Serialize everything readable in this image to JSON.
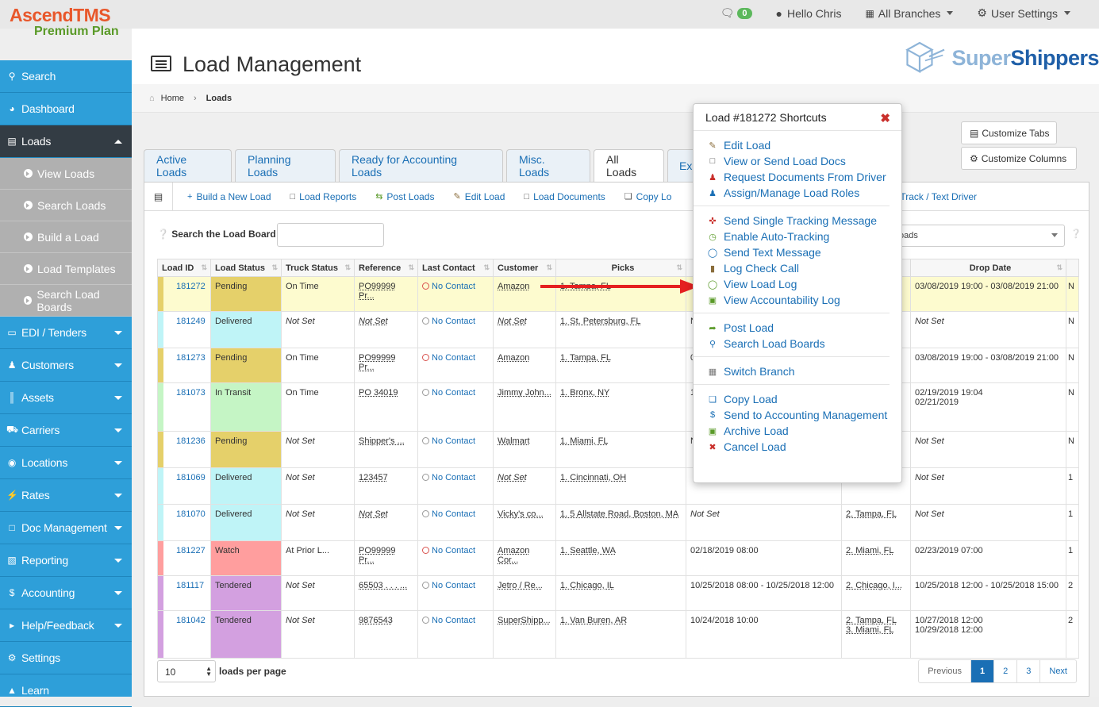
{
  "brand": {
    "name_a": "Ascend",
    "name_b": "TMS",
    "plan": "Premium Plan",
    "company_a": "Super",
    "company_b": "Shippers"
  },
  "top": {
    "messages_count": "0",
    "greeting": "Hello Chris",
    "branches": "All Branches",
    "settings": "User Settings"
  },
  "sidebar": {
    "items": [
      {
        "label": "Search",
        "icon": "search-icon"
      },
      {
        "label": "Dashboard",
        "icon": "dashboard-icon"
      },
      {
        "label": "Loads",
        "icon": "list-icon",
        "active": true
      },
      {
        "label": "EDI / Tenders",
        "icon": "inbox-icon"
      },
      {
        "label": "Customers",
        "icon": "users-icon"
      },
      {
        "label": "Assets",
        "icon": "barcode-icon"
      },
      {
        "label": "Carriers",
        "icon": "truck-icon"
      },
      {
        "label": "Locations",
        "icon": "map-marker-icon"
      },
      {
        "label": "Rates",
        "icon": "bolt-icon"
      },
      {
        "label": "Doc Management",
        "icon": "file-icon"
      },
      {
        "label": "Reporting",
        "icon": "report-icon"
      },
      {
        "label": "Accounting",
        "icon": "dollar-icon"
      },
      {
        "label": "Help/Feedback",
        "icon": "bullhorn-icon"
      },
      {
        "label": "Settings",
        "icon": "cogs-icon"
      },
      {
        "label": "Learn",
        "icon": "graduation-cap-icon"
      }
    ],
    "loads_sub": [
      "View Loads",
      "Search Loads",
      "Build a Load",
      "Load Templates",
      "Search Load Boards"
    ]
  },
  "page": {
    "title": "Load Management",
    "crumb_home": "Home",
    "crumb_current": "Loads"
  },
  "buttons": {
    "customize_tabs": "Customize Tabs",
    "customize_columns": "Customize Columns"
  },
  "tabs": [
    "Active Loads",
    "Planning Loads",
    "Ready for Accounting Loads",
    "Misc. Loads",
    "All Loads",
    "Ex"
  ],
  "toolbar": [
    "Build a New Load",
    "Load Reports",
    "Post Loads",
    "Edit Load",
    "Load Documents",
    "Copy Lo",
    "Track / Text Driver"
  ],
  "search": {
    "label": "Search the Load Board",
    "filter_value": "oads"
  },
  "table": {
    "headers": [
      "Load ID",
      "Load Status",
      "Truck Status",
      "Reference",
      "Last Contact",
      "Customer",
      "Picks",
      "",
      "",
      "Drop Date",
      ""
    ],
    "rows": [
      {
        "id": "181272",
        "status": "Pending",
        "truck": "On Time",
        "ref": "PO99999 Pr...",
        "contact": "No Contact",
        "customer": "Amazon",
        "picks": "1. Tampa, FL",
        "c8": "",
        "c9": "",
        "drop": "03/08/2019 19:00 - 03/08/2019 21:00",
        "c11": "N"
      },
      {
        "id": "181249",
        "status": "Delivered",
        "truck": "Not Set",
        "ref": "Not Set",
        "contact": "No Contact",
        "customer": "Not Set",
        "picks": "1. St. Petersburg, FL",
        "c8": "N",
        "c9": "",
        "drop": "Not Set",
        "c11": "N"
      },
      {
        "id": "181273",
        "status": "Pending",
        "truck": "On Time",
        "ref": "PO99999 Pr...",
        "contact": "No Contact",
        "customer": "Amazon",
        "picks": "1. Tampa, FL",
        "c8": "0",
        "c9": "",
        "drop": "03/08/2019 19:00 - 03/08/2019 21:00",
        "c11": "N"
      },
      {
        "id": "181073",
        "status": "In Transit",
        "truck": "On Time",
        "ref": "PO 34019",
        "contact": "No Contact",
        "customer": "Jimmy John...",
        "picks": "1. Bronx, NY",
        "c8": "1",
        "c9": "",
        "drop": "02/19/2019 19:04",
        "drop2": "02/21/2019",
        "c11": "N"
      },
      {
        "id": "181236",
        "status": "Pending",
        "truck": "Not Set",
        "ref": "Shipper's ...",
        "contact": "No Contact",
        "customer": "Walmart",
        "picks": "1. Miami, FL",
        "c8": "N",
        "c9": "",
        "drop": "Not Set",
        "c11": "N"
      },
      {
        "id": "181069",
        "status": "Delivered",
        "truck": "Not Set",
        "ref": "123457",
        "contact": "No Contact",
        "customer": "Not Set",
        "picks": "1. Cincinnati, OH",
        "c8": "",
        "c9": "",
        "drop": "Not Set",
        "c11": "1"
      },
      {
        "id": "181070",
        "status": "Delivered",
        "truck": "Not Set",
        "ref": "Not Set",
        "contact": "No Contact",
        "customer": "Vicky's co...",
        "picks": "1. 5 Allstate Road, Boston, MA",
        "c8": "Not Set",
        "c9": "2. Tampa, FL",
        "drop": "Not Set",
        "c11": "1"
      },
      {
        "id": "181227",
        "status": "Watch",
        "truck": "At Prior L...",
        "ref": "PO99999 Pr...",
        "contact": "No Contact",
        "customer": "Amazon Cor...",
        "picks": "1. Seattle, WA",
        "c8": "02/18/2019 08:00",
        "c9": "2. Miami, FL",
        "drop": "02/23/2019 07:00",
        "c11": "1"
      },
      {
        "id": "181117",
        "status": "Tendered",
        "truck": "Not Set",
        "ref": "65503 . . . ...",
        "contact": "No Contact",
        "customer": "Jetro / Re...",
        "picks": "1. Chicago, IL",
        "c8": "10/25/2018 08:00 - 10/25/2018 12:00",
        "c9": "2. Chicago, I...",
        "drop": "10/25/2018 12:00 - 10/25/2018 15:00",
        "c11": "2"
      },
      {
        "id": "181042",
        "status": "Tendered",
        "truck": "Not Set",
        "ref": "9876543",
        "contact": "No Contact",
        "customer": "SuperShipp...",
        "picks": "1. Van Buren, AR",
        "c8": "10/24/2018 10:00",
        "c9": "2. Tampa, FL",
        "c9b": "3. Miami, FL",
        "drop": "10/27/2018 12:00",
        "drop2": "10/29/2018 12:00",
        "c11": "2"
      }
    ]
  },
  "pagination": {
    "per_page": "10",
    "per_page_label": "loads per page",
    "previous": "Previous",
    "pages": [
      "1",
      "2",
      "3"
    ],
    "next": "Next"
  },
  "popup": {
    "title": "Load #181272 Shortcuts",
    "groups": [
      [
        {
          "label": "Edit Load",
          "icon": "pencil-icon"
        },
        {
          "label": "View or Send Load Docs",
          "icon": "file-text-icon"
        },
        {
          "label": "Request Documents From Driver",
          "icon": "user-icon"
        },
        {
          "label": "Assign/Manage Load Roles",
          "icon": "users-icon"
        }
      ],
      [
        {
          "label": "Send Single Tracking Message",
          "icon": "crosshairs-icon"
        },
        {
          "label": "Enable Auto-Tracking",
          "icon": "clock-icon"
        },
        {
          "label": "Send Text Message",
          "icon": "comment-icon"
        },
        {
          "label": "Log Check Call",
          "icon": "clipboard-icon"
        },
        {
          "label": "View Load Log",
          "icon": "comments-icon"
        },
        {
          "label": "View Accountability Log",
          "icon": "briefcase-icon"
        }
      ],
      [
        {
          "label": "Post Load",
          "icon": "share-icon"
        },
        {
          "label": "Search Load Boards",
          "icon": "search-icon"
        }
      ],
      [
        {
          "label": "Switch Branch",
          "icon": "sitemap-icon"
        }
      ],
      [
        {
          "label": "Copy Load",
          "icon": "copy-icon"
        },
        {
          "label": "Send to Accounting Management",
          "icon": "dollar-icon"
        },
        {
          "label": "Archive Load",
          "icon": "archive-icon"
        },
        {
          "label": "Cancel Load",
          "icon": "cancel-icon"
        }
      ]
    ]
  },
  "colors": {
    "pending": "#e5d06a",
    "delivered": "#bff4f7",
    "in_transit": "#c5f5c5",
    "watch": "#ff9e9e",
    "tendered": "#d3a0e0",
    "highlight_row": "#fdfbcf",
    "sidebar": "#2e9fd9",
    "link": "#1a6fb5",
    "arrow": "#e52020"
  }
}
